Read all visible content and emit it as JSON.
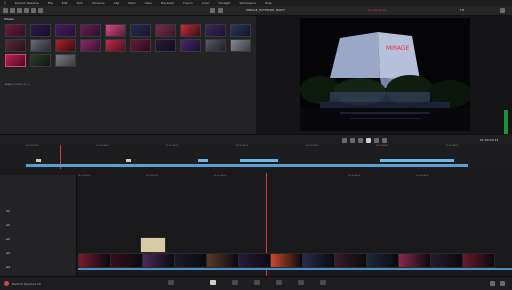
{
  "menubar": {
    "apple": "",
    "items": [
      "DaVinci Resolve",
      "File",
      "Edit",
      "Trim",
      "Timeline",
      "Clip",
      "Mark",
      "View",
      "Playback",
      "Fusion",
      "Color",
      "Fairlight",
      "Workspace",
      "Help"
    ]
  },
  "toolbar": {
    "viewer_title": "MIRAGE_EXTERIOR_NIGHT",
    "timecode_top": "01:00:04:20",
    "zoom": "FIT"
  },
  "mediapool": {
    "tab_label": "Master",
    "selected_thumb_label": "BRIAN_CLOSEUP_CUT_01"
  },
  "transport": {
    "timecode": "01:00:03:13"
  },
  "upper_ruler": [
    "01:00:00:00",
    "01:00:08:00",
    "01:00:16:00",
    "01:00:24:00",
    "01:00:32:00",
    "01:00:40:00",
    "01:00:48:00"
  ],
  "lower_ruler": [
    "01:00:00:00",
    "01:00:02:00",
    "01:00:04:00",
    "01:00:06:00",
    "01:00:08:00"
  ],
  "tracks": [
    "V1",
    "A1",
    "A2",
    "A3",
    "A4"
  ],
  "pages": [
    "Media",
    "Cut",
    "Edit",
    "Fusion",
    "Color",
    "Fairlight",
    "Deliver"
  ],
  "active_page": "Cut",
  "app_name": "DaVinci Resolve 16",
  "colors": {
    "accent_pink": "#d14a67",
    "timeline_blue": "#5a9fd0",
    "playhead_red": "#d23b3b",
    "scope_green": "#1f8f3a"
  }
}
